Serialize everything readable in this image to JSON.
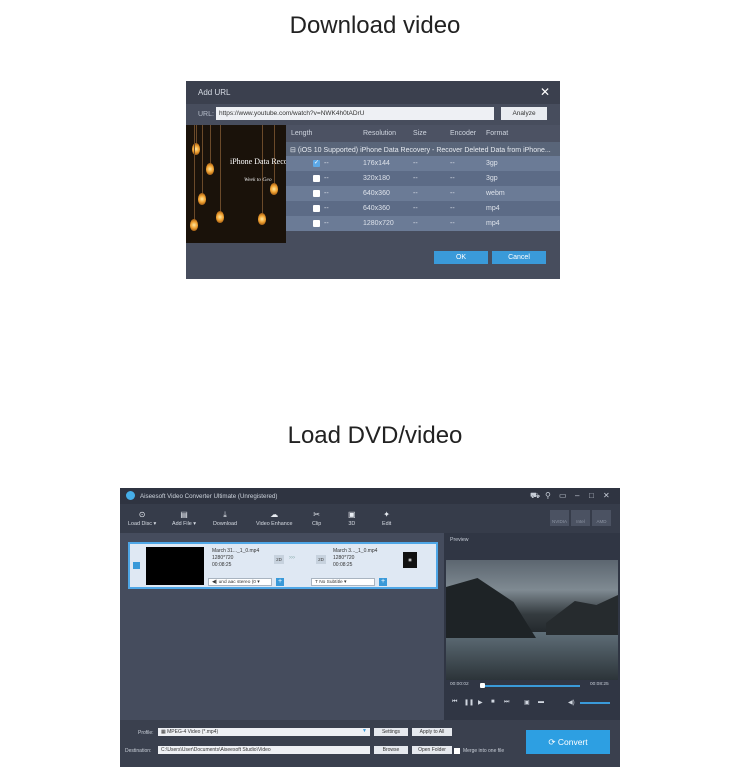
{
  "headings": {
    "download": "Download video",
    "load": "Load DVD/video"
  },
  "add_url_dialog": {
    "title": "Add URL",
    "url_label": "URL:",
    "url_value": "https://www.youtube.com/watch?v=NWK4h0tADrU",
    "analyze_label": "Analyze",
    "thumbnail_title": "iPhone Data Recovery",
    "thumbnail_subtitle": "Week to Geo",
    "columns": [
      "Length",
      "Resolution",
      "Size",
      "Encoder",
      "Format"
    ],
    "group_title": "(iOS 10 Supported) iPhone Data Recovery - Recover Deleted Data from iPhone...",
    "rows": [
      {
        "length": "--",
        "resolution": "176x144",
        "size": "--",
        "encoder": "--",
        "format": "3gp",
        "checked": true
      },
      {
        "length": "--",
        "resolution": "320x180",
        "size": "--",
        "encoder": "--",
        "format": "3gp",
        "checked": false
      },
      {
        "length": "--",
        "resolution": "640x360",
        "size": "--",
        "encoder": "--",
        "format": "webm",
        "checked": false
      },
      {
        "length": "--",
        "resolution": "640x360",
        "size": "--",
        "encoder": "--",
        "format": "mp4",
        "checked": false
      },
      {
        "length": "--",
        "resolution": "1280x720",
        "size": "--",
        "encoder": "--",
        "format": "mp4",
        "checked": false
      }
    ],
    "ok_label": "OK",
    "cancel_label": "Cancel"
  },
  "converter": {
    "title": "Aiseesoft Video Converter Ultimate (Unregistered)",
    "toolbar": [
      {
        "label": "Load Disc",
        "icon": "load-disc-icon",
        "glyph": "⊙"
      },
      {
        "label": "Add File",
        "icon": "add-file-icon",
        "glyph": "▤"
      },
      {
        "label": "Download",
        "icon": "download-icon",
        "glyph": "⤓"
      },
      {
        "label": "Video Enhance",
        "icon": "video-enhance-icon",
        "glyph": "☁"
      },
      {
        "label": "Clip",
        "icon": "clip-icon",
        "glyph": "✂"
      },
      {
        "label": "3D",
        "icon": "3d-icon",
        "glyph": "▣"
      },
      {
        "label": "Edit",
        "icon": "edit-icon",
        "glyph": "✦"
      }
    ],
    "right_tools": [
      "NVIDIA",
      "Intel",
      "AMD"
    ],
    "file_item": {
      "source_name": "March 31..._1_0.mp4",
      "source_res": "1280*720",
      "source_dur": "00:08:25",
      "badge_2d_left": "2D",
      "badge_2d_right": "2D",
      "target_name": "March 3..._1_0.mp4",
      "target_res": "1280*720",
      "target_dur": "00:08:25",
      "audio": "und aac stereo (0",
      "subtitle": "No Subtitle"
    },
    "preview_label": "Preview",
    "time_current": "00:00:02",
    "time_total": "00:08:25",
    "progress": 0.02,
    "profile_label": "Profile:",
    "profile_value": "MPEG-4 Video (*.mp4)",
    "settings_label": "Settings",
    "apply_all_label": "Apply to All",
    "destination_label": "Destination:",
    "destination_value": "C:\\Users\\User\\Documents\\Aiseesoft Studio\\Video",
    "browse_label": "Browse",
    "open_folder_label": "Open Folder",
    "merge_label": "Merge into one file",
    "convert_label": "Convert",
    "accent": "#2d9fe2"
  }
}
